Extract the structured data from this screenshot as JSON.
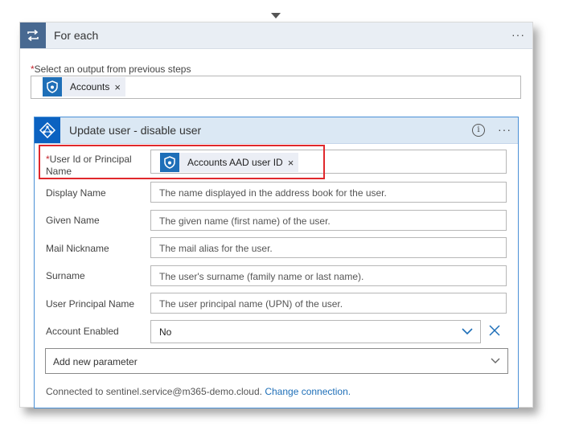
{
  "foreach": {
    "title": "For each",
    "more_label": "···",
    "select_required": "*",
    "select_label": "Select an output from previous steps",
    "select_token": "Accounts",
    "remove_token": "×"
  },
  "action": {
    "title": "Update user - disable user",
    "info_label": "i",
    "more_label": "···",
    "fields": [
      {
        "label": "User Id or Principal Name",
        "required": "*",
        "token": "Accounts AAD user ID",
        "remove_token": "×"
      },
      {
        "label": "Display Name",
        "placeholder": "The name displayed in the address book for the user."
      },
      {
        "label": "Given Name",
        "placeholder": "The given name (first name) of the user."
      },
      {
        "label": "Mail Nickname",
        "placeholder": "The mail alias for the user."
      },
      {
        "label": "Surname",
        "placeholder": "The user's surname (family name or last name)."
      },
      {
        "label": "User Principal Name",
        "placeholder": "The user principal name (UPN) of the user."
      },
      {
        "label": "Account Enabled",
        "value": "No"
      }
    ],
    "add_parameter": "Add new parameter",
    "connected_text": "Connected to sentinel.service@m365-demo.cloud.",
    "change_connection": "Change connection."
  },
  "colors": {
    "foreach_icon_bg": "#486991",
    "aad_icon_bg": "#0b62c1",
    "token_icon_bg": "#1e6fb8",
    "highlight": "#e0282c",
    "link": "#1e6fb8"
  },
  "icons": [
    "loop-icon",
    "more-icon",
    "sentinel-shield-icon",
    "azure-ad-icon",
    "info-icon",
    "chevron-down-icon",
    "clear-icon"
  ]
}
